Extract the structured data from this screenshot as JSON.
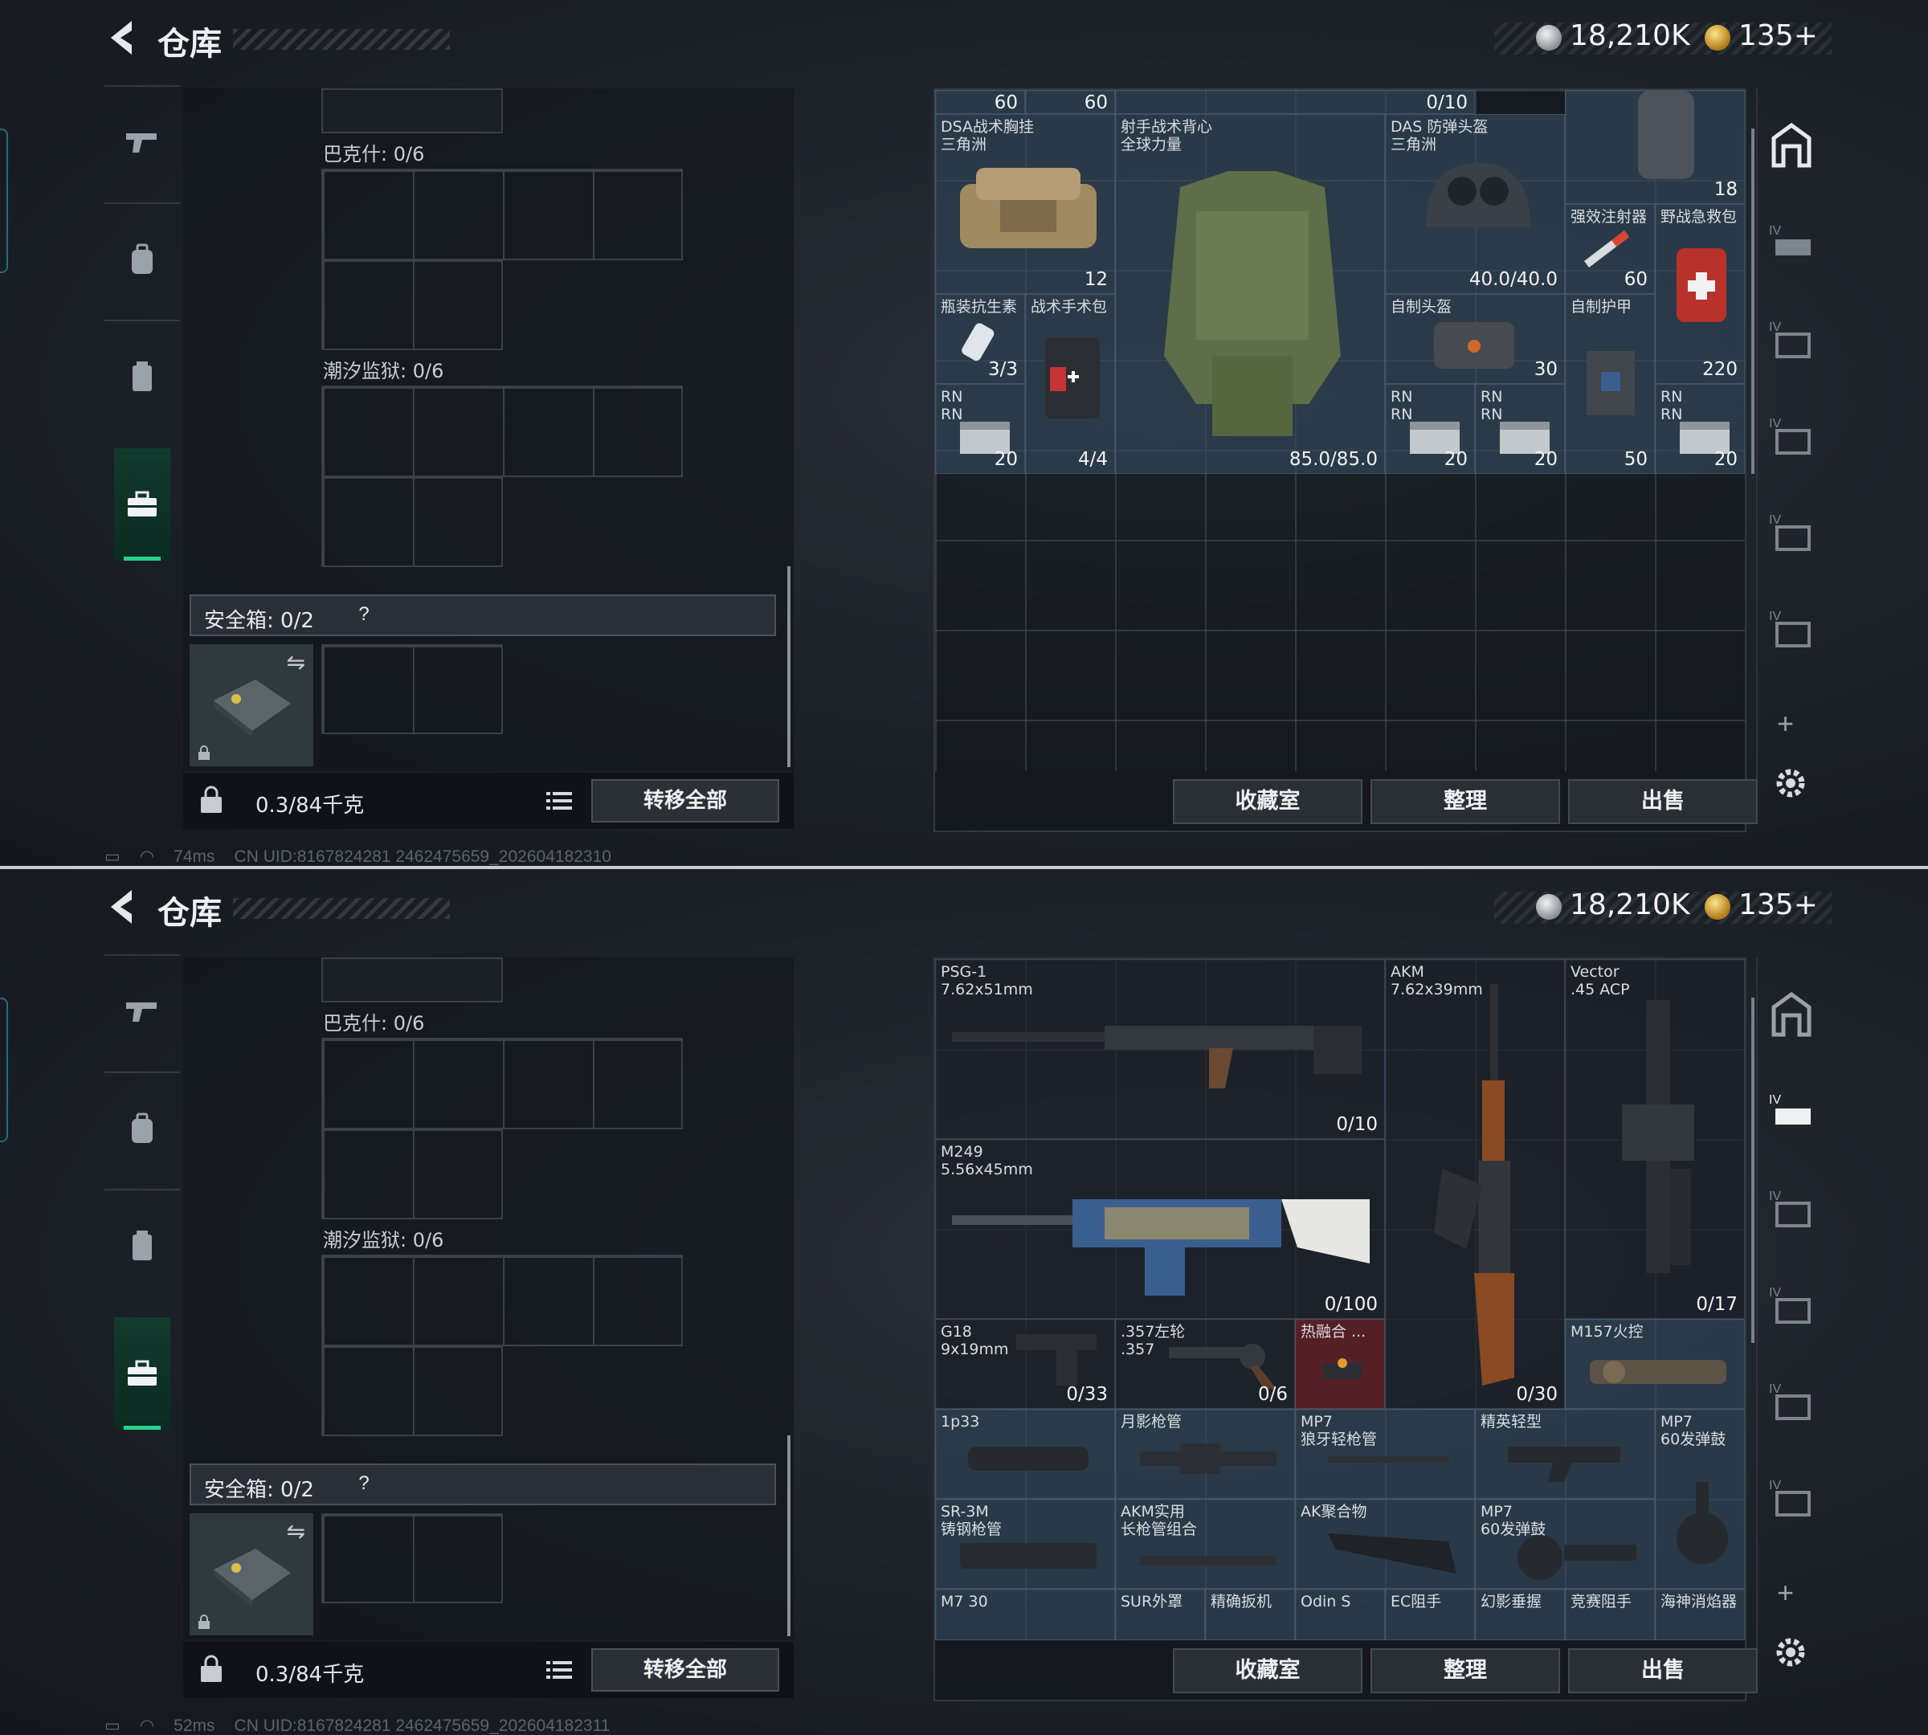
{
  "header": {
    "title": "仓库",
    "currency_silver": "18,210K",
    "currency_gold": "135+"
  },
  "left": {
    "sections": [
      "巴克什: 0/6",
      "潮汐监狱: 0/6"
    ],
    "safe_box": "安全箱: 0/2",
    "help": "?",
    "weight": "0.3/84千克",
    "transfer_all": "转移全部"
  },
  "buttons": {
    "collection": "收藏室",
    "sort": "整理",
    "sell": "出售"
  },
  "status1": {
    "ping": "74ms",
    "uid": "CN UID:8167824281 2462475659_202604182310"
  },
  "status2": {
    "ping": "52ms",
    "uid": "CN UID:8167824281 2462475659_202604182311"
  },
  "gear_items": {
    "top_partial": [
      "60",
      "60",
      "0/10"
    ],
    "vest": {
      "name": "DSA战术胸挂\n三角洲",
      "val": "12"
    },
    "armor": {
      "name": "射手战术背心\n全球力量",
      "val": "85.0/85.0"
    },
    "helmet": {
      "name": "DAS 防弹头盔\n三角洲",
      "val": "40.0/40.0"
    },
    "backpack_val": "18",
    "injector": {
      "name": "强效注射器",
      "val": "60"
    },
    "firstaid": {
      "name": "野战急救包",
      "val": "220"
    },
    "antibiotic": {
      "name": "瓶装抗生素",
      "val": "3/3"
    },
    "surgery": {
      "name": "战术手术包",
      "val": "4/4"
    },
    "diy_helmet": {
      "name": "自制头盔",
      "val": "30"
    },
    "diy_armor": {
      "name": "自制护甲",
      "val": "50"
    },
    "ammo_label": "RN\nRN",
    "ammo_val": "20"
  },
  "weapon_items": {
    "psg": {
      "name": "PSG-1\n7.62x51mm",
      "val": "0/10"
    },
    "akm": {
      "name": "AKM\n7.62x39mm",
      "val": "0/30"
    },
    "vector": {
      "name": "Vector\n.45 ACP",
      "val": "0/17"
    },
    "m249": {
      "name": "M249\n5.56x45mm",
      "val": "0/100"
    },
    "g18": {
      "name": "G18\n9x19mm",
      "val": "0/33"
    },
    "revolver": {
      "name": ".357左轮\n.357",
      "val": "0/6"
    },
    "thermal": {
      "name": "热融合 ..."
    },
    "m157": {
      "name": "M157火控"
    },
    "p1p33": {
      "name": "1p33"
    },
    "moonshadow": {
      "name": "月影枪管"
    },
    "mp7_barrel": {
      "name": "MP7\n狼牙轻枪管"
    },
    "elite_stock": {
      "name": "精英轻型"
    },
    "mp7_drum": {
      "name": "MP7\n60发弹鼓"
    },
    "sr3m": {
      "name": "SR-3M\n铸钢枪管"
    },
    "akm_barrel": {
      "name": "AKM实用\n长枪管组合"
    },
    "ak_stock": {
      "name": "AK聚合物"
    },
    "mp7_mag": {
      "name": "MP7\n60发弹鼓"
    },
    "bottom_row": [
      "M7 30",
      "SUR外罩",
      "精确扳机",
      "Odin S",
      "EC阻手",
      "幻影垂握",
      "竞赛阻手",
      "海神消焰器"
    ]
  }
}
